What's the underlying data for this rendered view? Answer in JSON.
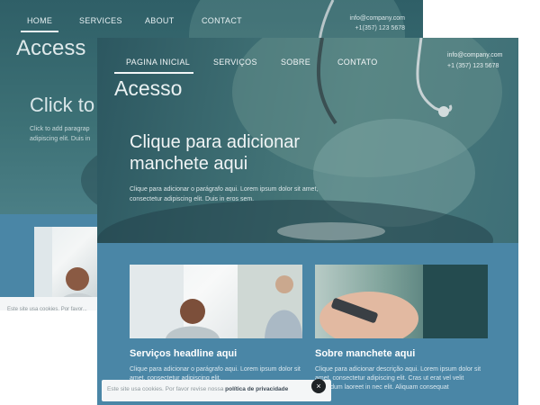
{
  "back_site": {
    "nav": [
      "HOME",
      "SERVICES",
      "ABOUT",
      "CONTACT"
    ],
    "logo": "Access",
    "contact": {
      "email": "info@company.com",
      "phone": "+1(357) 123 5678"
    },
    "headline": "Click to a",
    "paragraph": "Click to add paragrap adipiscing elit. Duis in",
    "cookie_text": "Este site usa cookies. Por favor..."
  },
  "front_site": {
    "nav": {
      "home": "PAGINA INICIAL",
      "services": "SERVIÇOS",
      "about": "SOBRE",
      "contact": "CONTATO"
    },
    "logo": "Acesso",
    "contact": {
      "email": "info@company.com",
      "phone": "+1 (357) 123 5678"
    },
    "headline": "Clique para adicionar manchete aqui",
    "hero_paragraph": "Clique para adicionar o parágrafo aqui. Lorem ipsum dolor sit amet, consectetur adipiscing elit. Duis in eros sem.",
    "cards": [
      {
        "title": "Serviços headline aqui",
        "text": "Clique para adicionar o parágrafo aqui. Lorem ipsum dolor sit amet, consectetur adipiscing elit."
      },
      {
        "title": "Sobre manchete aqui",
        "text": "Clique para adicionar descrição aqui. Lorem ipsum dolor sit amet, consectetur adipiscing elit. Cras ut erat vel velit bibendum laoreet in nec elit. Aliquam consequat"
      }
    ],
    "cookie": {
      "text": "Este site usa cookies. Por favor revise nossa",
      "link": "política de privacidade",
      "close": "×"
    }
  },
  "colors": {
    "hero_teal": "#3d6d72",
    "band_blue": "#4a86a6",
    "text_white": "#ffffff",
    "cookie_bg": "#f4f6f7"
  }
}
